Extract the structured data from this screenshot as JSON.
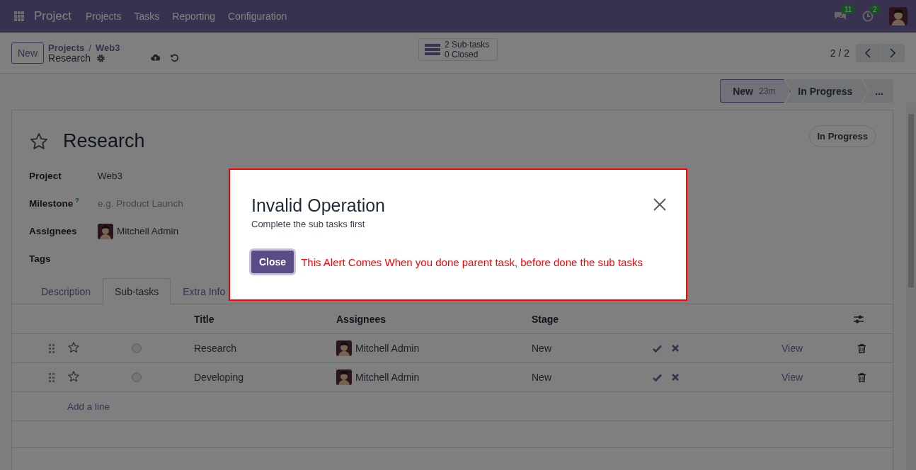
{
  "navbar": {
    "app_name": "Project",
    "menu": [
      "Projects",
      "Tasks",
      "Reporting",
      "Configuration"
    ],
    "messages_badge": "11",
    "activities_badge": "2"
  },
  "control_panel": {
    "new_button": "New",
    "breadcrumb": [
      "Projects",
      "Web3"
    ],
    "breadcrumb_separator": "/",
    "record": "Research",
    "subtasks_count": "2 Sub-tasks",
    "subtasks_closed": "0 Closed",
    "pager": "2 / 2"
  },
  "stages": [
    {
      "label": "New",
      "duration": "23m",
      "selected": true
    },
    {
      "label": "In Progress",
      "selected": false
    },
    {
      "label": "...",
      "selected": false
    }
  ],
  "task": {
    "title": "Research",
    "starred": false,
    "state": "In Progress",
    "fields": [
      {
        "kind": "text",
        "label": "Project",
        "value": "Web3"
      },
      {
        "kind": "placeholder",
        "label": "Milestone",
        "help": "?",
        "placeholder": "e.g. Product Launch"
      },
      {
        "kind": "user",
        "label": "Assignees",
        "value": "Mitchell Admin"
      },
      {
        "kind": "tags",
        "label": "Tags"
      }
    ]
  },
  "tabs": [
    {
      "label": "Description",
      "selected": false
    },
    {
      "label": "Sub-tasks",
      "selected": true
    },
    {
      "label": "Extra Info",
      "selected": false
    }
  ],
  "subtasks": {
    "columns": [
      "Title",
      "Assignees",
      "Stage"
    ],
    "rows": [
      {
        "title": "Research",
        "assignee": "Mitchell Admin",
        "stage": "New",
        "starred": false,
        "action": "View"
      },
      {
        "title": "Developing",
        "assignee": "Mitchell Admin",
        "stage": "New",
        "starred": false,
        "action": "View"
      }
    ],
    "add_line": "Add a line"
  },
  "dialog": {
    "title": "Invalid Operation",
    "message": "Complete the sub tasks first",
    "button": "Close",
    "note": "This Alert Comes When you done parent task, before done the sub tasks"
  }
}
